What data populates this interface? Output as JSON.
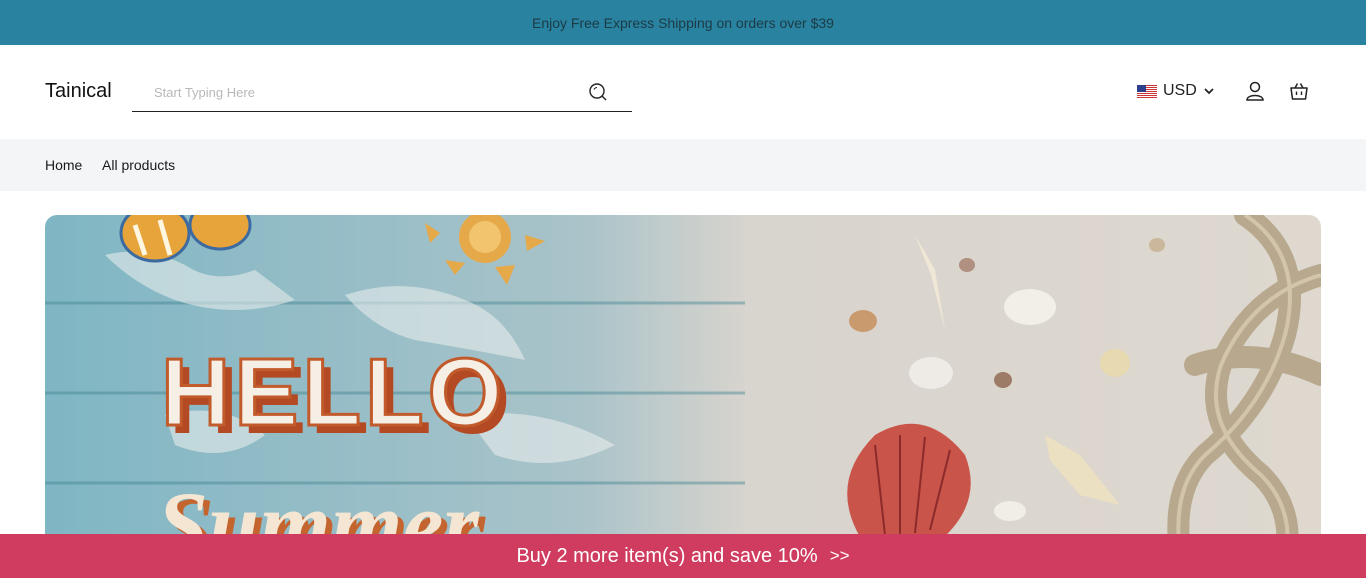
{
  "announcement": {
    "text": "Enjoy Free Express Shipping on orders over $39"
  },
  "header": {
    "logo": "Tainical",
    "search": {
      "placeholder": "Start Typing Here",
      "value": ""
    },
    "currency": {
      "code": "USD"
    }
  },
  "nav": {
    "items": [
      {
        "label": "Home"
      },
      {
        "label": "All products"
      }
    ]
  },
  "banner": {
    "headline_top": "HELLO",
    "headline_bottom": "Summer"
  },
  "promo": {
    "text": "Buy 2 more item(s) and save 10%",
    "arrows": ">>"
  },
  "colors": {
    "announcement_bg": "#2882a0",
    "promo_bg": "#cf3c5f",
    "nav_bg": "#f4f5f7"
  }
}
